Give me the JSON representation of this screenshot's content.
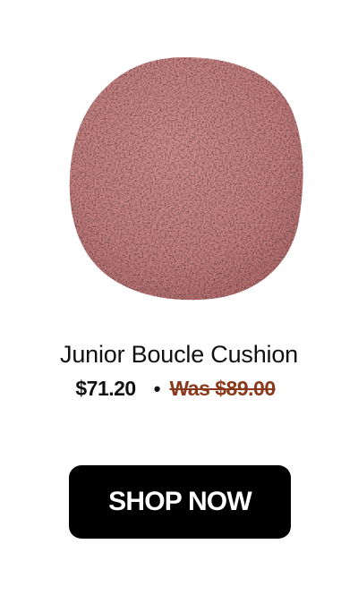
{
  "product": {
    "image_icon": "round-boucle-cushion-image",
    "title": "Junior Boucle Cushion",
    "sale_price": "$71.20",
    "separator": "•",
    "was_price": "Was $89.00"
  },
  "cta": {
    "label": "SHOP NOW"
  },
  "colors": {
    "cushion": "#c98383",
    "was_price": "#8a3a1c",
    "button_bg": "#000000",
    "button_text": "#ffffff"
  }
}
